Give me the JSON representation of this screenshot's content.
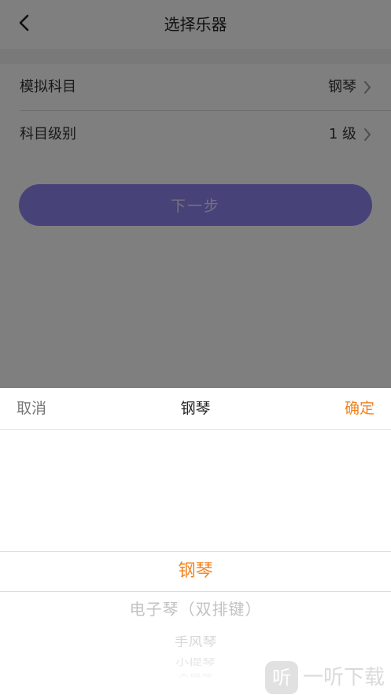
{
  "nav": {
    "title": "选择乐器"
  },
  "form": {
    "subject_label": "模拟科目",
    "subject_value": "钢琴",
    "level_label": "科目级别",
    "level_value": "1 级",
    "next_label": "下一步"
  },
  "picker": {
    "cancel_label": "取消",
    "title": "钢琴",
    "confirm_label": "确定",
    "options": [
      "钢琴",
      "电子琴（双排键）",
      "手风琴",
      "小提琴",
      "大提琴"
    ],
    "selected_index": 0
  },
  "watermark": {
    "logo_char": "听",
    "text": "一听下载"
  },
  "colors": {
    "accent": "#f0821e",
    "button": "#8f85f0",
    "overlay": "rgba(0,0,0,0.5)"
  }
}
